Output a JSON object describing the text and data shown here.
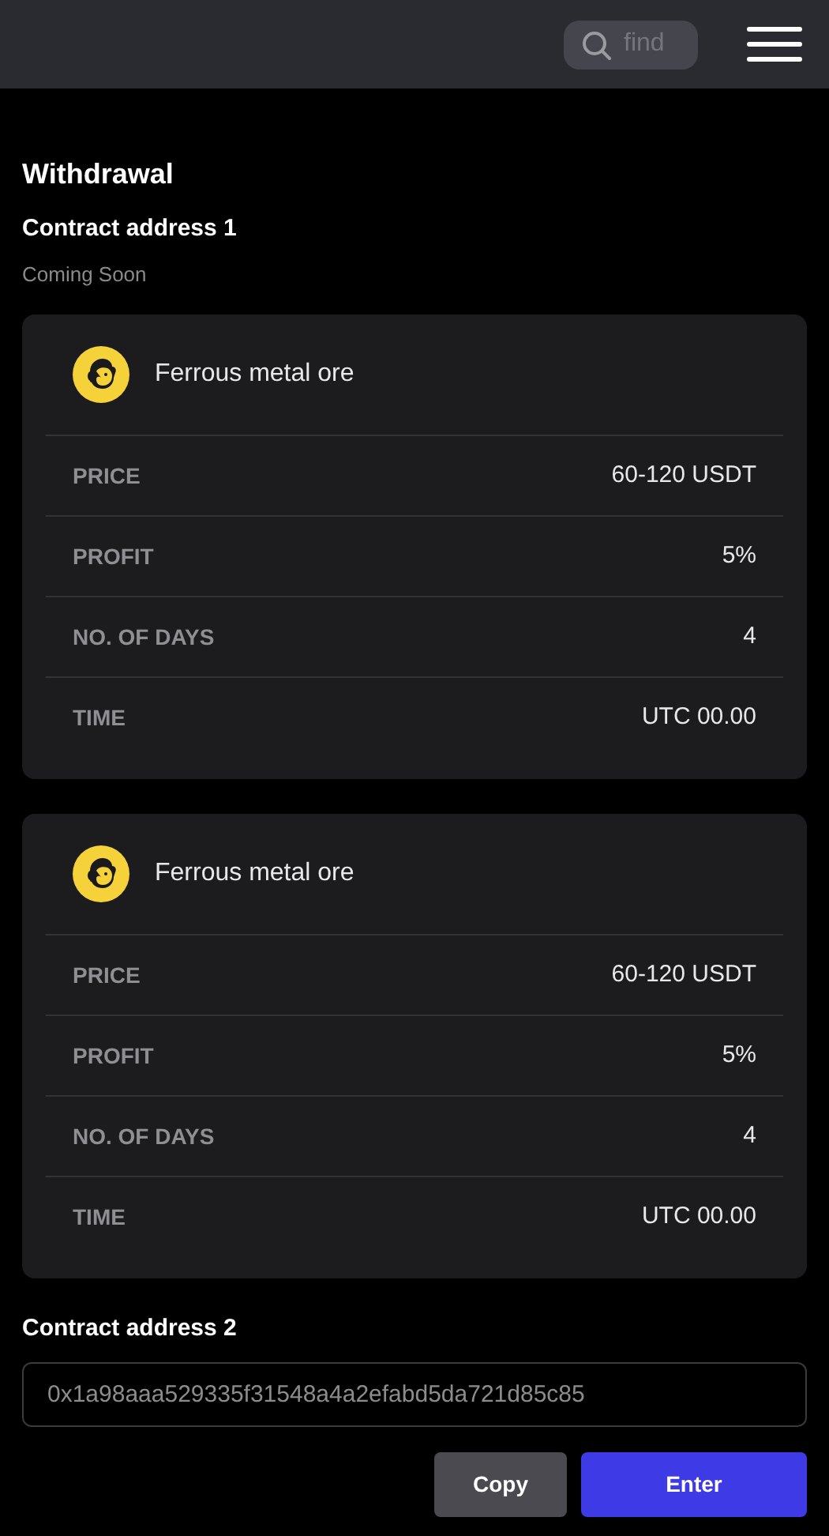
{
  "header": {
    "search": {
      "placeholder": "find"
    }
  },
  "title": "Withdrawal",
  "section_1": {
    "heading": "Contract address 1",
    "note": "Coming Soon"
  },
  "cards": [
    {
      "name": "Ferrous metal ore",
      "rows": [
        {
          "label": "PRICE",
          "value": "60-120 USDT"
        },
        {
          "label": "PROFIT",
          "value": "5%"
        },
        {
          "label": "NO. OF DAYS",
          "value": "4"
        },
        {
          "label": "TIME",
          "value": "UTC 00.00"
        }
      ]
    },
    {
      "name": "Ferrous metal ore",
      "rows": [
        {
          "label": "PRICE",
          "value": "60-120 USDT"
        },
        {
          "label": "PROFIT",
          "value": "5%"
        },
        {
          "label": "NO. OF DAYS",
          "value": "4"
        },
        {
          "label": "TIME",
          "value": "UTC 00.00"
        }
      ]
    }
  ],
  "section_2": {
    "heading": "Contract address 2",
    "address": "0x1a98aaa529335f31548a4a2efabd5da721d85c85"
  },
  "buttons": [
    {
      "label": "Copy",
      "kind": "secondary"
    },
    {
      "label": "Enter",
      "kind": "primary"
    }
  ]
}
